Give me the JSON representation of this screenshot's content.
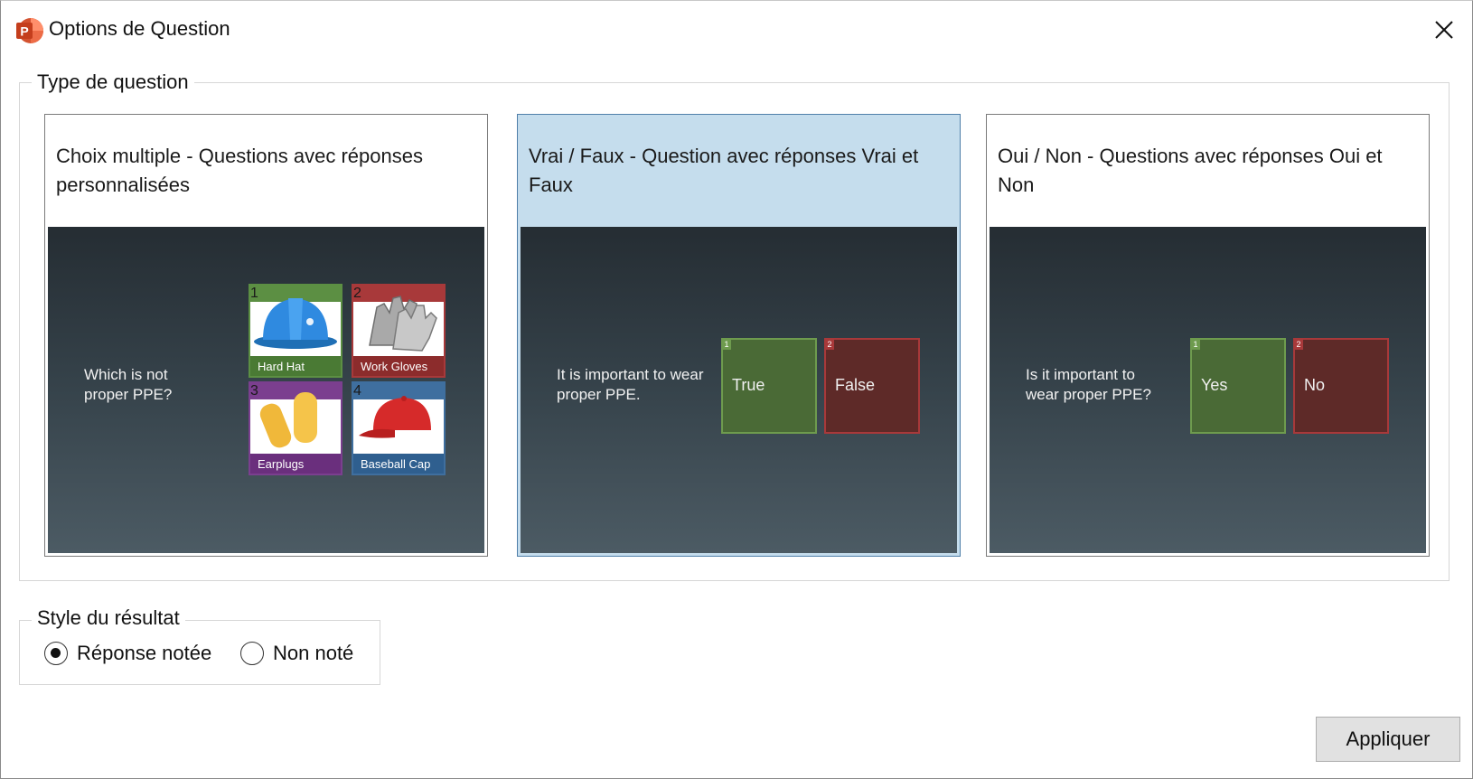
{
  "window": {
    "title": "Options de Question",
    "app_icon": "powerpoint-icon",
    "close_icon": "close-icon"
  },
  "question_type": {
    "legend": "Type de question",
    "cards": [
      {
        "label": "Choix multiple - Questions avec réponses personnalisées",
        "selected": false,
        "preview": {
          "question": "Which is not proper PPE?",
          "answers": [
            {
              "num": "1",
              "label": "Hard Hat",
              "icon": "hard-hat-image",
              "color": "#4a7a34"
            },
            {
              "num": "2",
              "label": "Work Gloves",
              "icon": "work-gloves-image",
              "color": "#8c2c2c"
            },
            {
              "num": "3",
              "label": "Earplugs",
              "icon": "earplugs-image",
              "color": "#6a2f7d"
            },
            {
              "num": "4",
              "label": "Baseball Cap",
              "icon": "baseball-cap-image",
              "color": "#2f5f8f"
            }
          ]
        }
      },
      {
        "label": "Vrai / Faux - Question avec réponses Vrai et Faux",
        "selected": true,
        "preview": {
          "question": "It is important to wear proper PPE.",
          "answers": [
            {
              "num": "1",
              "label": "True",
              "color": "#4a6a36"
            },
            {
              "num": "2",
              "label": "False",
              "color": "#5e2a28"
            }
          ]
        }
      },
      {
        "label": "Oui / Non - Questions avec réponses Oui et Non",
        "selected": false,
        "preview": {
          "question": "Is it important to wear proper PPE?",
          "answers": [
            {
              "num": "1",
              "label": "Yes",
              "color": "#4a6a36"
            },
            {
              "num": "2",
              "label": "No",
              "color": "#5e2a28"
            }
          ]
        }
      }
    ]
  },
  "result_style": {
    "legend": "Style du résultat",
    "options": [
      {
        "label": "Réponse notée",
        "checked": true
      },
      {
        "label": "Non noté",
        "checked": false
      }
    ]
  },
  "apply_button": "Appliquer",
  "colors": {
    "selected_card": "#c5dded",
    "selected_border": "#4f7fa9",
    "preview_bg_top": "#252d33",
    "preview_bg_bottom": "#4c5b64"
  }
}
